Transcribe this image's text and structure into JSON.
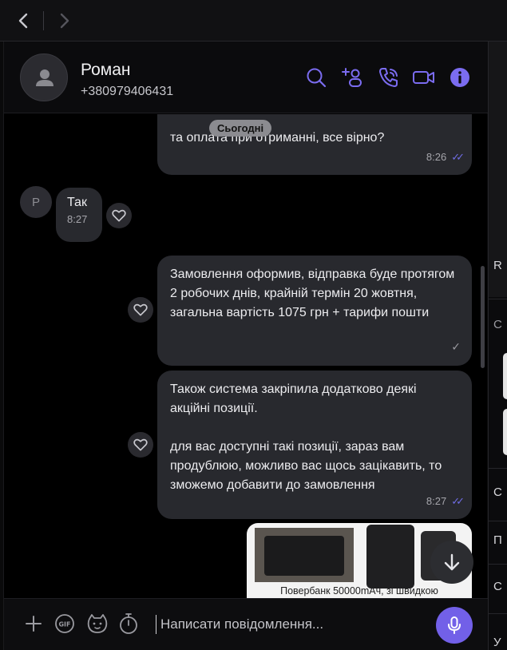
{
  "contact": {
    "name": "Роман",
    "phone": "+380979406431",
    "initial": "Р"
  },
  "date_label": "Сьогодні",
  "messages": {
    "m1": {
      "text": "та оплата при отриманні, все вірно?",
      "time": "8:26",
      "status": "read"
    },
    "m2": {
      "text": "Так",
      "time": "8:27"
    },
    "m3": {
      "text": "Замовлення оформив, відправка буде протягом 2 робочих днів, крайній термін 20 жовтня, загальна вартість 1075 грн + тарифи пошти",
      "status": "delivered"
    },
    "m4": {
      "line1": "Також система закріпила додатково деякі акційні позиції.",
      "line2": "для вас доступні такі позиції, зараз вам продублюю, можливо вас щось зацікавить, то зможемо добавити до замовлення",
      "time": "8:27",
      "status": "read"
    },
    "m5": {
      "caption": "Повербанк 50000mAч, зі швидкою"
    }
  },
  "composer": {
    "placeholder": "Написати повідомлення..."
  },
  "icons": {
    "back": "chevron-left-icon",
    "forward": "chevron-right-icon",
    "search": "search-icon",
    "add_participant": "add-user-icon",
    "call": "phone-icon",
    "video": "video-icon",
    "info": "info-icon",
    "attach": "plus-icon",
    "gif": "gif-icon",
    "sticker": "sticker-icon",
    "timer": "timer-icon",
    "mic": "mic-icon",
    "scroll_down": "arrow-down-icon",
    "like": "heart-icon"
  },
  "side_panel": {
    "letters": [
      "R",
      "С",
      "С",
      "П",
      "С",
      "У"
    ]
  },
  "colors": {
    "accent": "#7260e8",
    "bubble": "#28292e",
    "background": "#000000",
    "read_ticks": "#6f6ce3"
  }
}
